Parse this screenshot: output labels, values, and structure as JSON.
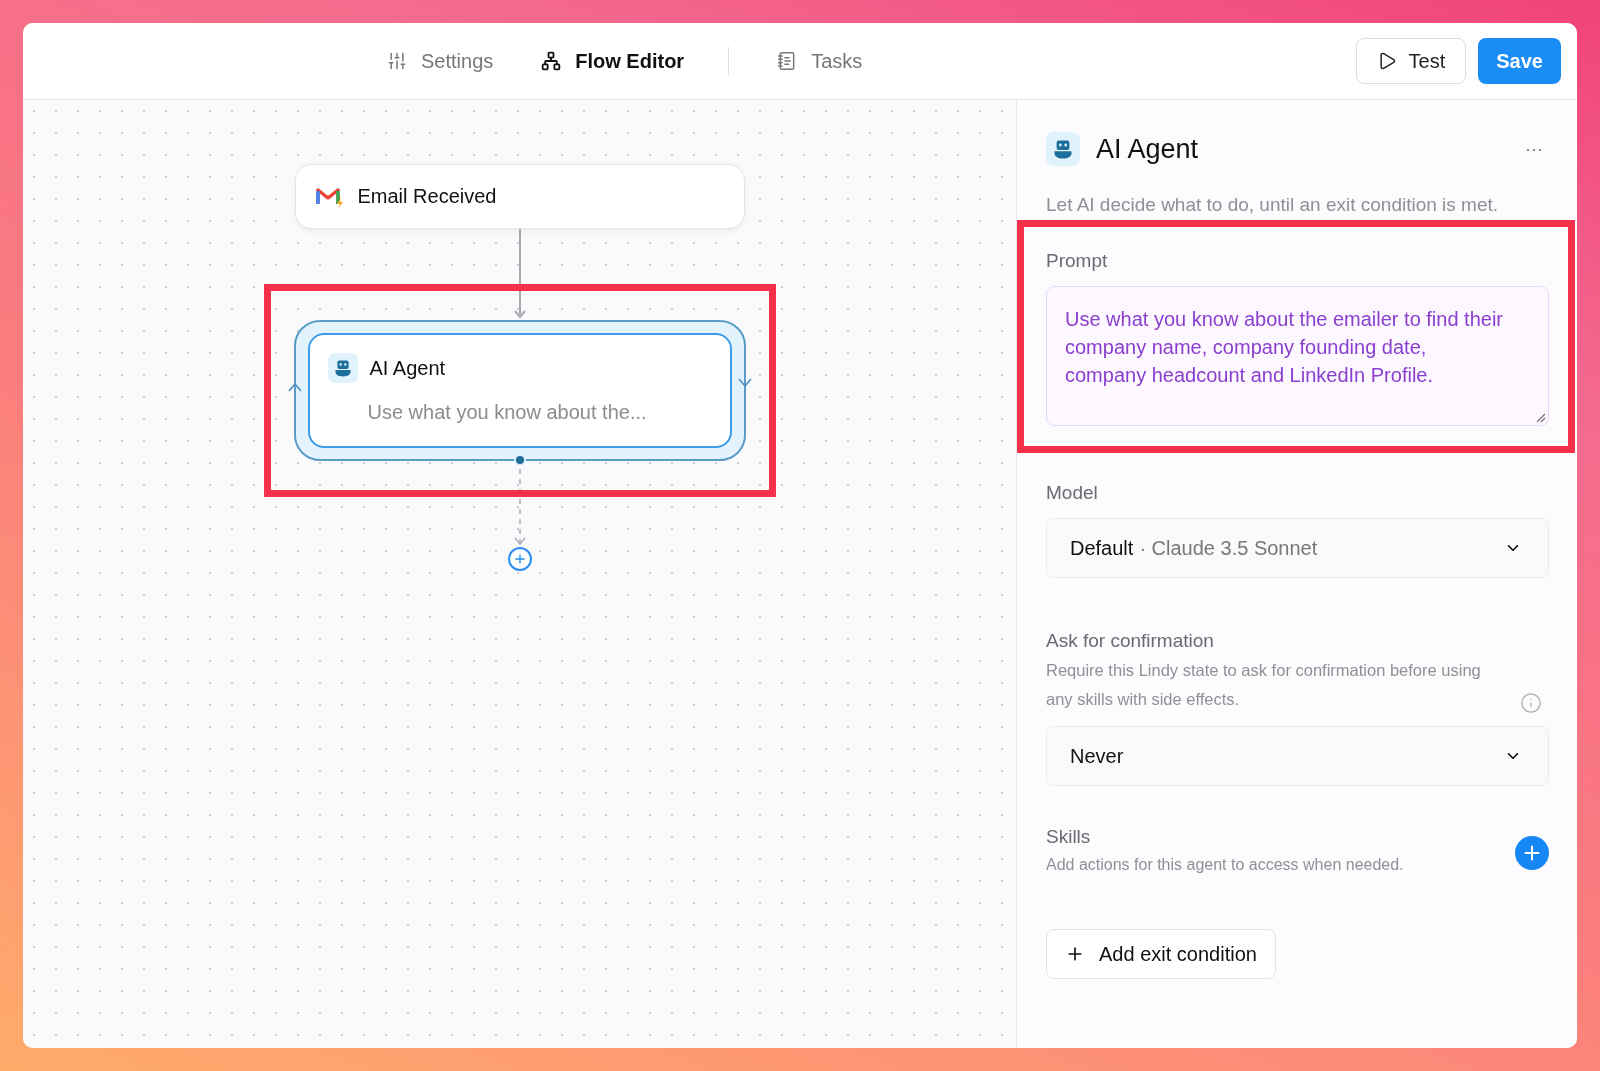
{
  "tabs": [
    {
      "label": "Settings",
      "selected": false
    },
    {
      "label": "Flow Editor",
      "selected": true
    },
    {
      "label": "Tasks",
      "selected": false
    }
  ],
  "actions": {
    "test": "Test",
    "save": "Save"
  },
  "canvas": {
    "trigger": {
      "title": "Email Received"
    },
    "agent": {
      "title": "AI Agent",
      "summary": "Use what you know about the...",
      "highlighted": true
    }
  },
  "panel": {
    "title": "AI Agent",
    "menu": "···",
    "description": "Let AI decide what to do, until an exit condition is met.",
    "prompt": {
      "label": "Prompt",
      "value": "Use what you know about the emailer to find their company name, company founding date, company headcount and LinkedIn Profile.",
      "highlighted": true
    },
    "model": {
      "label": "Model",
      "value": "Default",
      "detail": "· Claude 3.5 Sonnet"
    },
    "confirmation": {
      "label": "Ask for confirmation",
      "help": "Require this Lindy state to ask for confirmation before using any skills with side effects.",
      "value": "Never"
    },
    "skills": {
      "label": "Skills",
      "help": "Add actions for this agent to access when needed."
    },
    "exit_button": "Add exit condition"
  }
}
